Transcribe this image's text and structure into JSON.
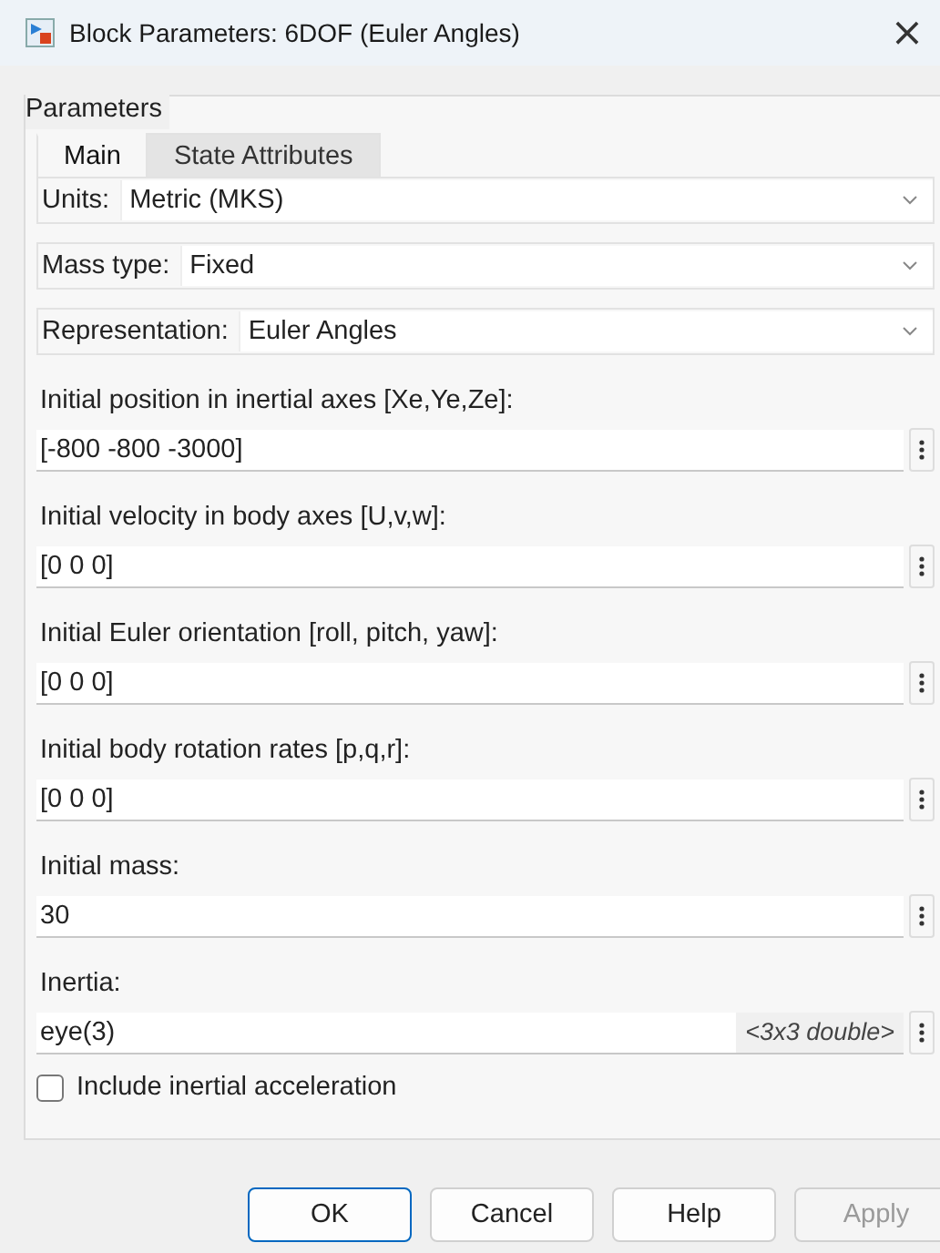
{
  "window": {
    "title": "Block Parameters: 6DOF (Euler Angles)",
    "close": "×"
  },
  "group": {
    "title": "Parameters"
  },
  "tabs": [
    {
      "label": "Main",
      "selected": true
    },
    {
      "label": "State Attributes",
      "selected": false
    }
  ],
  "dropdowns": [
    {
      "label": "Units:",
      "value": "Metric (MKS)"
    },
    {
      "label": "Mass type:",
      "value": "Fixed"
    },
    {
      "label": "Representation:",
      "value": "Euler Angles"
    }
  ],
  "fields": [
    {
      "label": "Initial position in inertial axes [Xe,Ye,Ze]:",
      "value": "[-800 -800 -3000]"
    },
    {
      "label": "Initial velocity in body axes [U,v,w]:",
      "value": "[0 0 0]"
    },
    {
      "label": "Initial Euler orientation [roll, pitch, yaw]:",
      "value": "[0 0 0]"
    },
    {
      "label": "Initial body rotation rates [p,q,r]:",
      "value": "[0 0 0]"
    },
    {
      "label": "Initial mass:",
      "value": "30"
    },
    {
      "label": "Inertia:",
      "value": "eye(3)",
      "type_hint": "<3x3 double>"
    }
  ],
  "checkbox": {
    "label": "Include inertial acceleration",
    "checked": false
  },
  "buttons": [
    {
      "label": "OK",
      "disabled": false,
      "default": true
    },
    {
      "label": "Cancel",
      "disabled": false,
      "default": false
    },
    {
      "label": "Help",
      "disabled": false,
      "default": false
    },
    {
      "label": "Apply",
      "disabled": true,
      "default": false
    }
  ]
}
